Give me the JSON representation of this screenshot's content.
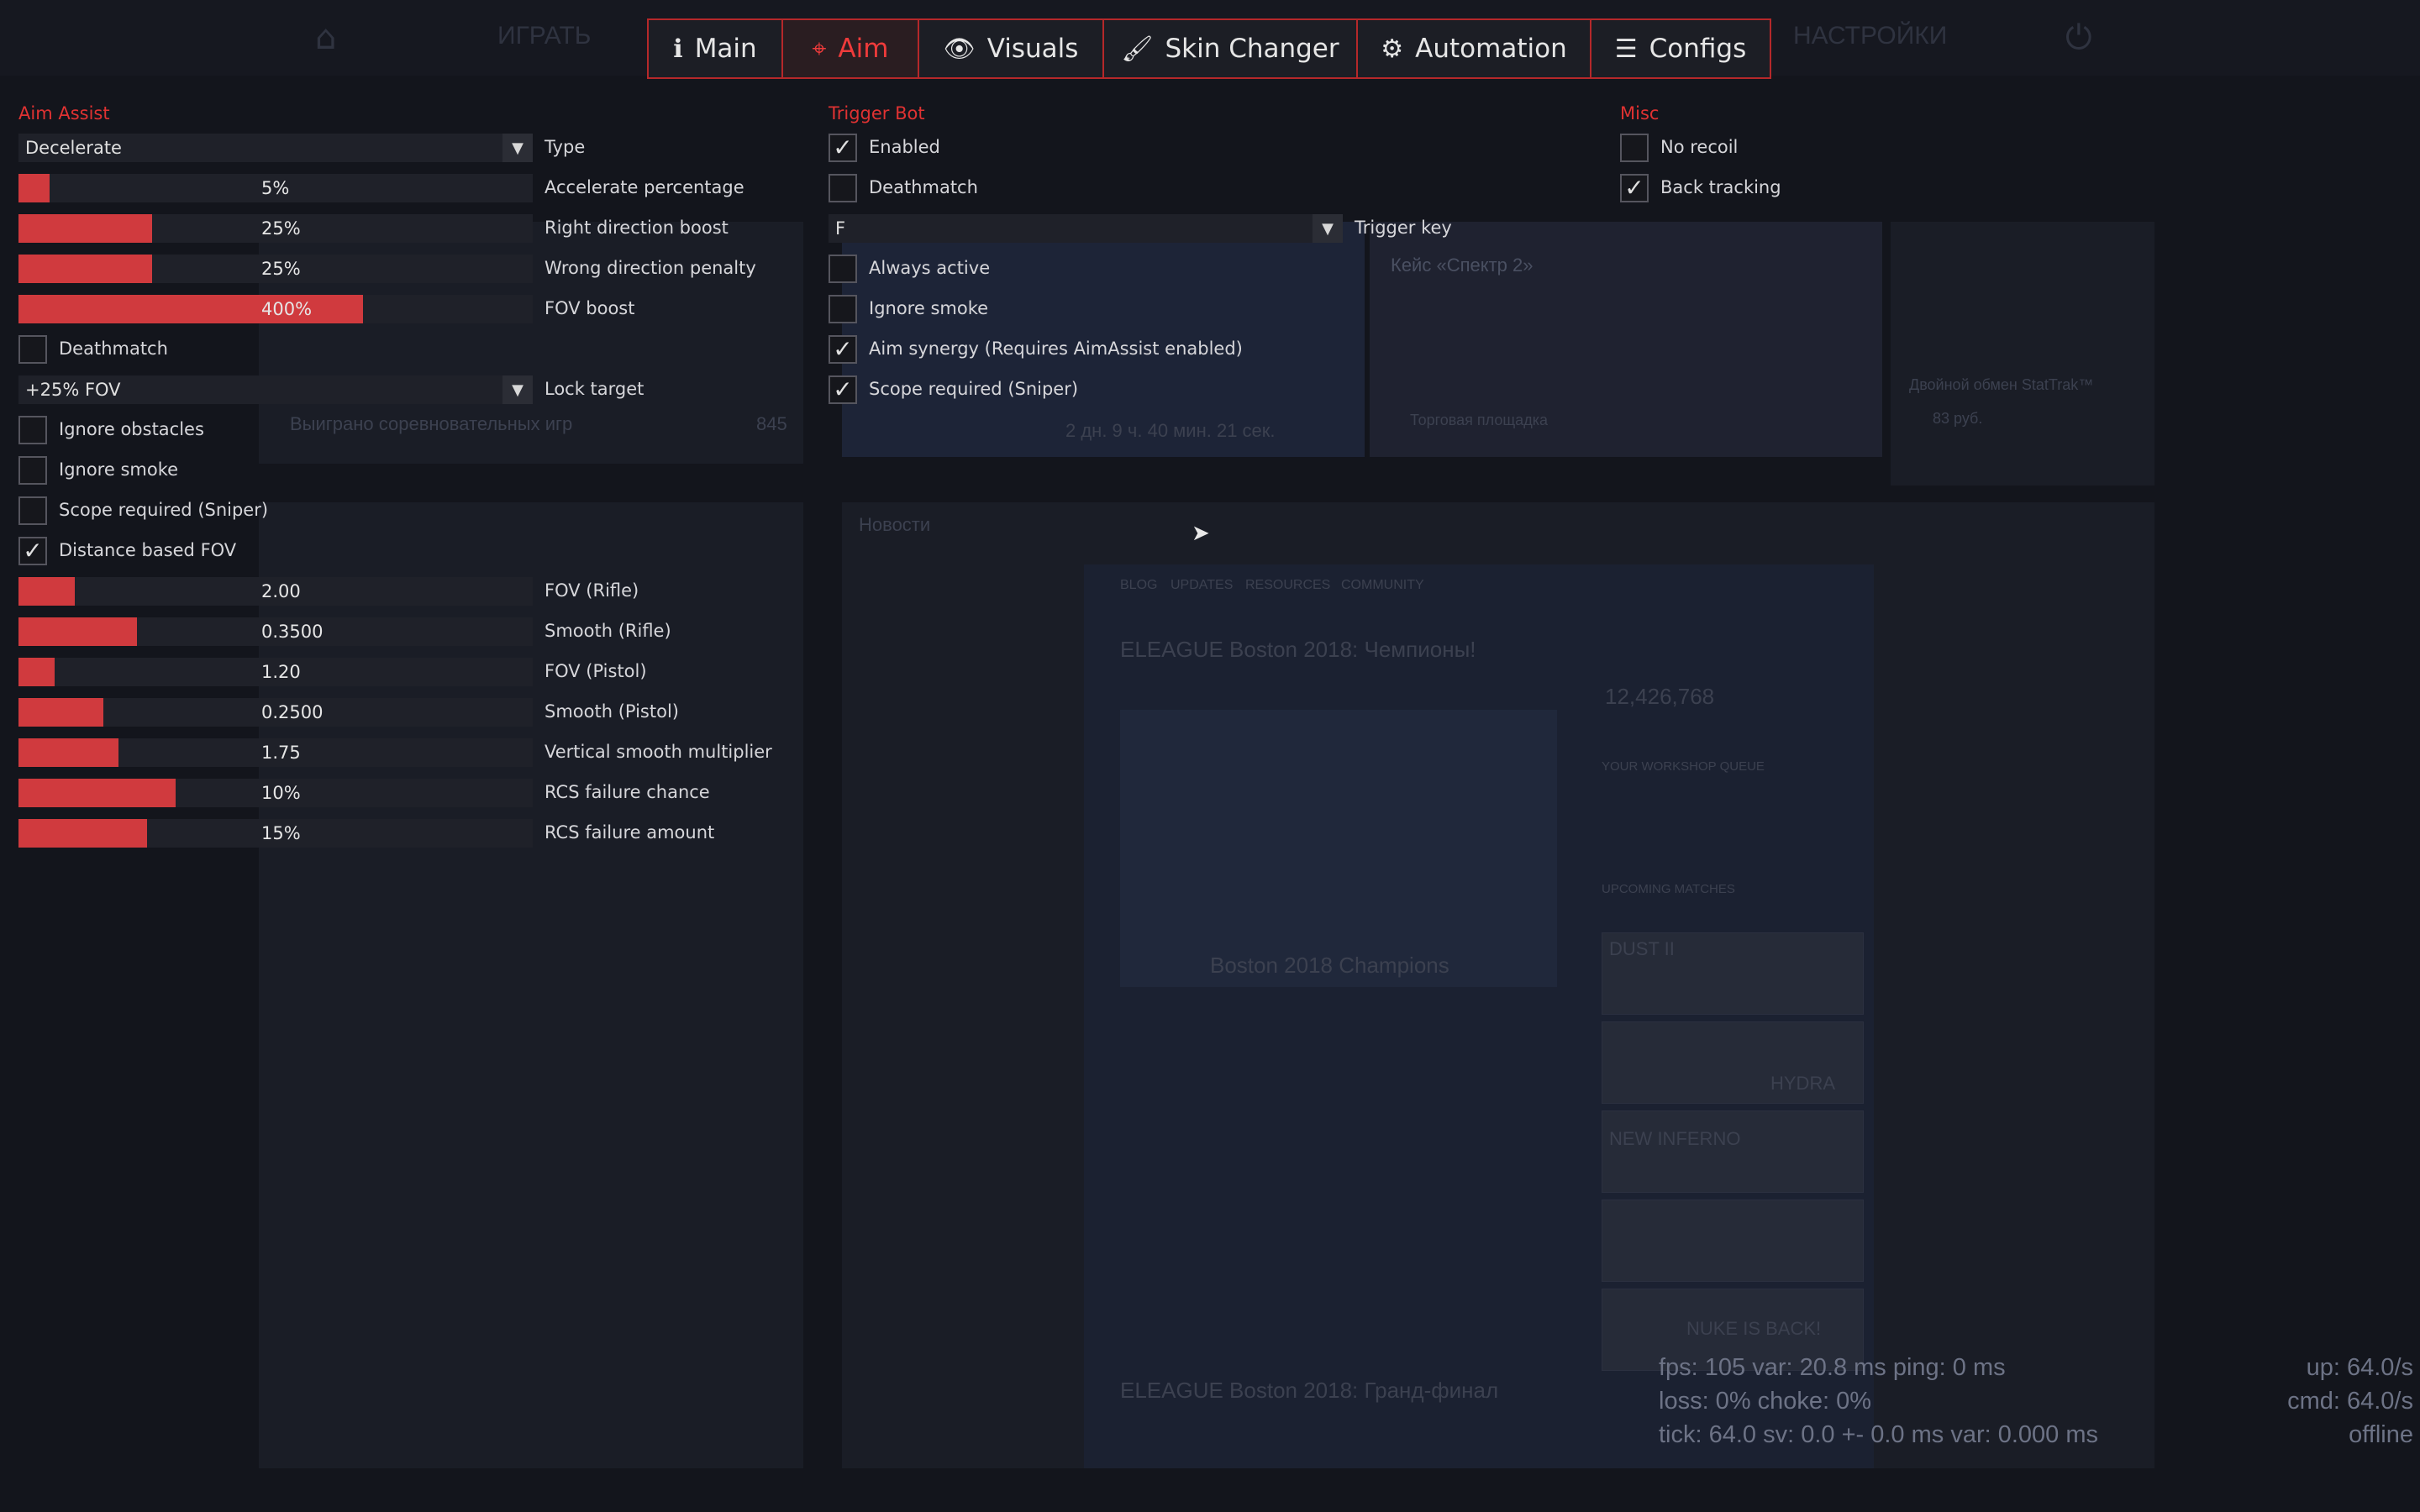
{
  "game_nav": {
    "home_icon": "home-icon",
    "play": "ИГРАТЬ",
    "settings": "НАСТРОЙКИ",
    "power_icon": "power-icon"
  },
  "tabs": [
    {
      "label": "Main",
      "icon": "info-icon",
      "glyph": "ℹ",
      "active": false
    },
    {
      "label": "Aim",
      "icon": "crosshair-icon",
      "glyph": "⌖",
      "active": true
    },
    {
      "label": "Visuals",
      "icon": "eye-icon",
      "glyph": "👁",
      "active": false
    },
    {
      "label": "Skin Changer",
      "icon": "paintbrush-icon",
      "glyph": "🖌",
      "active": false
    },
    {
      "label": "Automation",
      "icon": "gears-icon",
      "glyph": "⚙",
      "active": false
    },
    {
      "label": "Configs",
      "icon": "sliders-icon",
      "glyph": "☰",
      "active": false
    }
  ],
  "aim_assist": {
    "title": "Aim Assist",
    "type": {
      "value": "Decelerate",
      "label": "Type"
    },
    "sliders1": [
      {
        "label": "Accelerate percentage",
        "value": "5%",
        "fill": 0.06
      },
      {
        "label": "Right direction boost",
        "value": "25%",
        "fill": 0.26
      },
      {
        "label": "Wrong direction penalty",
        "value": "25%",
        "fill": 0.26
      },
      {
        "label": "FOV boost",
        "value": "400%",
        "fill": 0.67
      }
    ],
    "deathmatch": {
      "label": "Deathmatch",
      "checked": false
    },
    "lock_target": {
      "value": "+25% FOV",
      "label": "Lock target"
    },
    "checks": [
      {
        "label": "Ignore obstacles",
        "checked": false
      },
      {
        "label": "Ignore smoke",
        "checked": false
      },
      {
        "label": "Scope required (Sniper)",
        "checked": false
      },
      {
        "label": "Distance based FOV",
        "checked": true
      }
    ],
    "sliders2": [
      {
        "label": "FOV (Rifle)",
        "value": "2.00",
        "fill": 0.11
      },
      {
        "label": "Smooth (Rifle)",
        "value": "0.3500",
        "fill": 0.23
      },
      {
        "label": "FOV (Pistol)",
        "value": "1.20",
        "fill": 0.07
      },
      {
        "label": "Smooth (Pistol)",
        "value": "0.2500",
        "fill": 0.165
      },
      {
        "label": "Vertical smooth multiplier",
        "value": "1.75",
        "fill": 0.195
      },
      {
        "label": "RCS failure chance",
        "value": "10%",
        "fill": 0.305
      },
      {
        "label": "RCS failure amount",
        "value": "15%",
        "fill": 0.25
      }
    ]
  },
  "trigger_bot": {
    "title": "Trigger Bot",
    "checks_top": [
      {
        "label": "Enabled",
        "checked": true
      },
      {
        "label": "Deathmatch",
        "checked": false
      }
    ],
    "trigger_key": {
      "value": "F",
      "label": "Trigger key"
    },
    "checks_bottom": [
      {
        "label": "Always active",
        "checked": false
      },
      {
        "label": "Ignore smoke",
        "checked": false
      },
      {
        "label": "Aim synergy (Requires AimAssist enabled)",
        "checked": true
      },
      {
        "label": "Scope required (Sniper)",
        "checked": true
      }
    ]
  },
  "misc": {
    "title": "Misc",
    "checks": [
      {
        "label": "No recoil",
        "checked": false
      },
      {
        "label": "Back tracking",
        "checked": true
      }
    ]
  },
  "background": {
    "news_title": "Новости",
    "blog_nav": [
      "BLOG",
      "UPDATES",
      "RESOURCES",
      "COMMUNITY"
    ],
    "article_title": "ELEAGUE Boston 2018: Чемпионы!",
    "article_caption": "Boston 2018 Champions",
    "article_title2": "ELEAGUE Boston 2018: Гранд-финал",
    "players_count": "12,426,768",
    "workshop_queue": "YOUR WORKSHOP QUEUE",
    "upcoming_matches": "UPCOMING MATCHES",
    "matches": [
      "DUST II",
      "HYDRA",
      "NEW INFERNO",
      "",
      "NUKE IS BACK!"
    ],
    "case_title": "Кейс «Спектр 2»",
    "market": "Торговая площадка",
    "stattrak": "Двойной обмен StatTrak™",
    "price": "83 руб.",
    "won_games": "Выиграно соревновательных игр",
    "won_count": "845",
    "timer": "2 дн. 9 ч. 40 мин. 21 сек."
  },
  "net_graph": {
    "line1": "fps:    105  var: 20.8 ms  ping: 0 ms",
    "line2": "loss:   0%  choke: 0%",
    "line3": "tick: 64.0  sv:  0.0 +- 0.0 ms   var:  0.000 ms",
    "right1": "up: 64.0/s",
    "right2": "cmd: 64.0/s",
    "right3": "offline"
  }
}
